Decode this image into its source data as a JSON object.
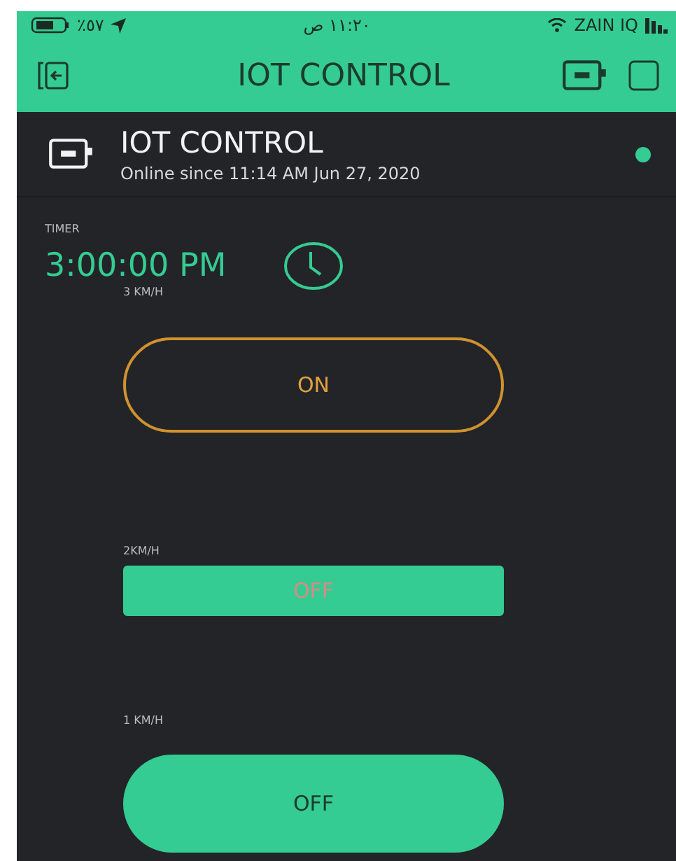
{
  "status_bar": {
    "battery": "٪٥٧",
    "time": "١١:٢٠ ص",
    "carrier": "ZAIN IQ"
  },
  "app_bar": {
    "title": "IOT CONTROL"
  },
  "device": {
    "name": "IOT CONTROL",
    "status": "Online since 11:14 AM Jun 27, 2020",
    "online": true
  },
  "timer": {
    "label": "TIMER",
    "value": "3:00:00 PM"
  },
  "widgets": [
    {
      "label": "3 KM/H",
      "kind": "outline",
      "text": "ON"
    },
    {
      "label": "2KM/H",
      "kind": "flat",
      "text": "OFF"
    },
    {
      "label": "1 KM/H",
      "kind": "pill",
      "text": "OFF"
    }
  ]
}
